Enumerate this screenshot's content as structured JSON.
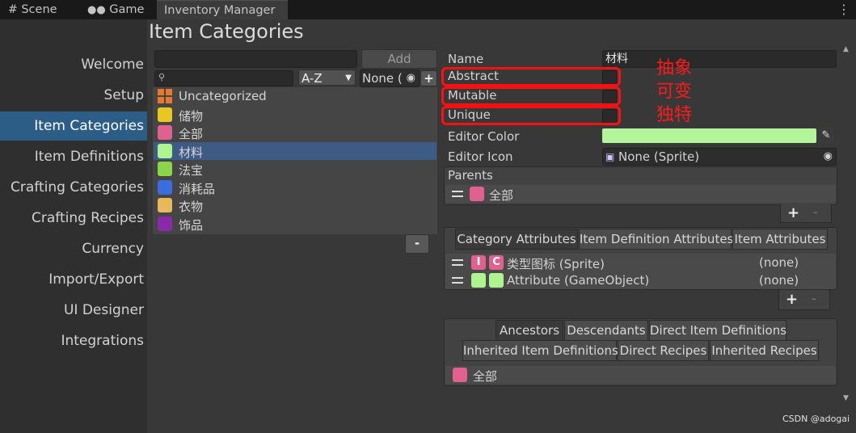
{
  "tabs": [
    {
      "label": "Scene"
    },
    {
      "label": "Game"
    },
    {
      "label": "Inventory Manager"
    }
  ],
  "page_title": "Item Categories",
  "sidebar": {
    "items": [
      {
        "label": "Welcome"
      },
      {
        "label": "Setup"
      },
      {
        "label": "Item Categories"
      },
      {
        "label": "Item Definitions"
      },
      {
        "label": "Crafting Categories"
      },
      {
        "label": "Crafting Recipes"
      },
      {
        "label": "Currency"
      },
      {
        "label": "Import/Export"
      },
      {
        "label": "UI Designer"
      },
      {
        "label": "Integrations"
      }
    ]
  },
  "list": {
    "add_label": "Add",
    "sort_value": "A-Z",
    "filter_value": "None (",
    "items": [
      {
        "label": "Uncategorized",
        "color": "#e8782a"
      },
      {
        "label": "储物",
        "color": "#e8c81e"
      },
      {
        "label": "全部",
        "color": "#e06090"
      },
      {
        "label": "材料",
        "color": "#aef590"
      },
      {
        "label": "法宝",
        "color": "#8ad54a"
      },
      {
        "label": "消耗品",
        "color": "#3a6ee0"
      },
      {
        "label": "衣物",
        "color": "#e8b85a"
      },
      {
        "label": "饰品",
        "color": "#8a2aa8"
      }
    ],
    "remove_label": "-"
  },
  "details": {
    "name_label": "Name",
    "name_value": "材料",
    "abstract_label": "Abstract",
    "mutable_label": "Mutable",
    "unique_label": "Unique",
    "editor_color_label": "Editor Color",
    "editor_color_value": "#b3f59a",
    "editor_icon_label": "Editor Icon",
    "editor_icon_value": "None (Sprite)",
    "parents_label": "Parents",
    "parent_item": "全部",
    "parent_color": "#e06090",
    "plus": "+",
    "minus": "-"
  },
  "annotation": {
    "lines": [
      "抽象",
      "可变",
      "独特"
    ],
    "color": "#ff1a1a"
  },
  "attributes": {
    "tabs": [
      {
        "label": "Category Attributes"
      },
      {
        "label": "Item Definition Attributes"
      },
      {
        "label": "Item Attributes"
      }
    ],
    "rows": [
      {
        "b1": "I",
        "b2": "C",
        "b1_color": "#e06090",
        "b2_color": "#e06090",
        "name": "类型图标 (Sprite)",
        "value": "(none)"
      },
      {
        "b1": "",
        "b2": "",
        "b1_color": "#aef590",
        "b2_color": "#aef590",
        "name": "Attribute (GameObject)",
        "value": "(none)"
      }
    ]
  },
  "relations": {
    "tabs_row1": [
      {
        "label": "Ancestors"
      },
      {
        "label": "Descendants"
      },
      {
        "label": "Direct Item Definitions"
      }
    ],
    "tabs_row2": [
      {
        "label": "Inherited Item Definitions"
      },
      {
        "label": "Direct Recipes"
      },
      {
        "label": "Inherited Recipes"
      }
    ],
    "item": "全部",
    "item_color": "#e06090"
  },
  "watermark": "CSDN @adogai"
}
